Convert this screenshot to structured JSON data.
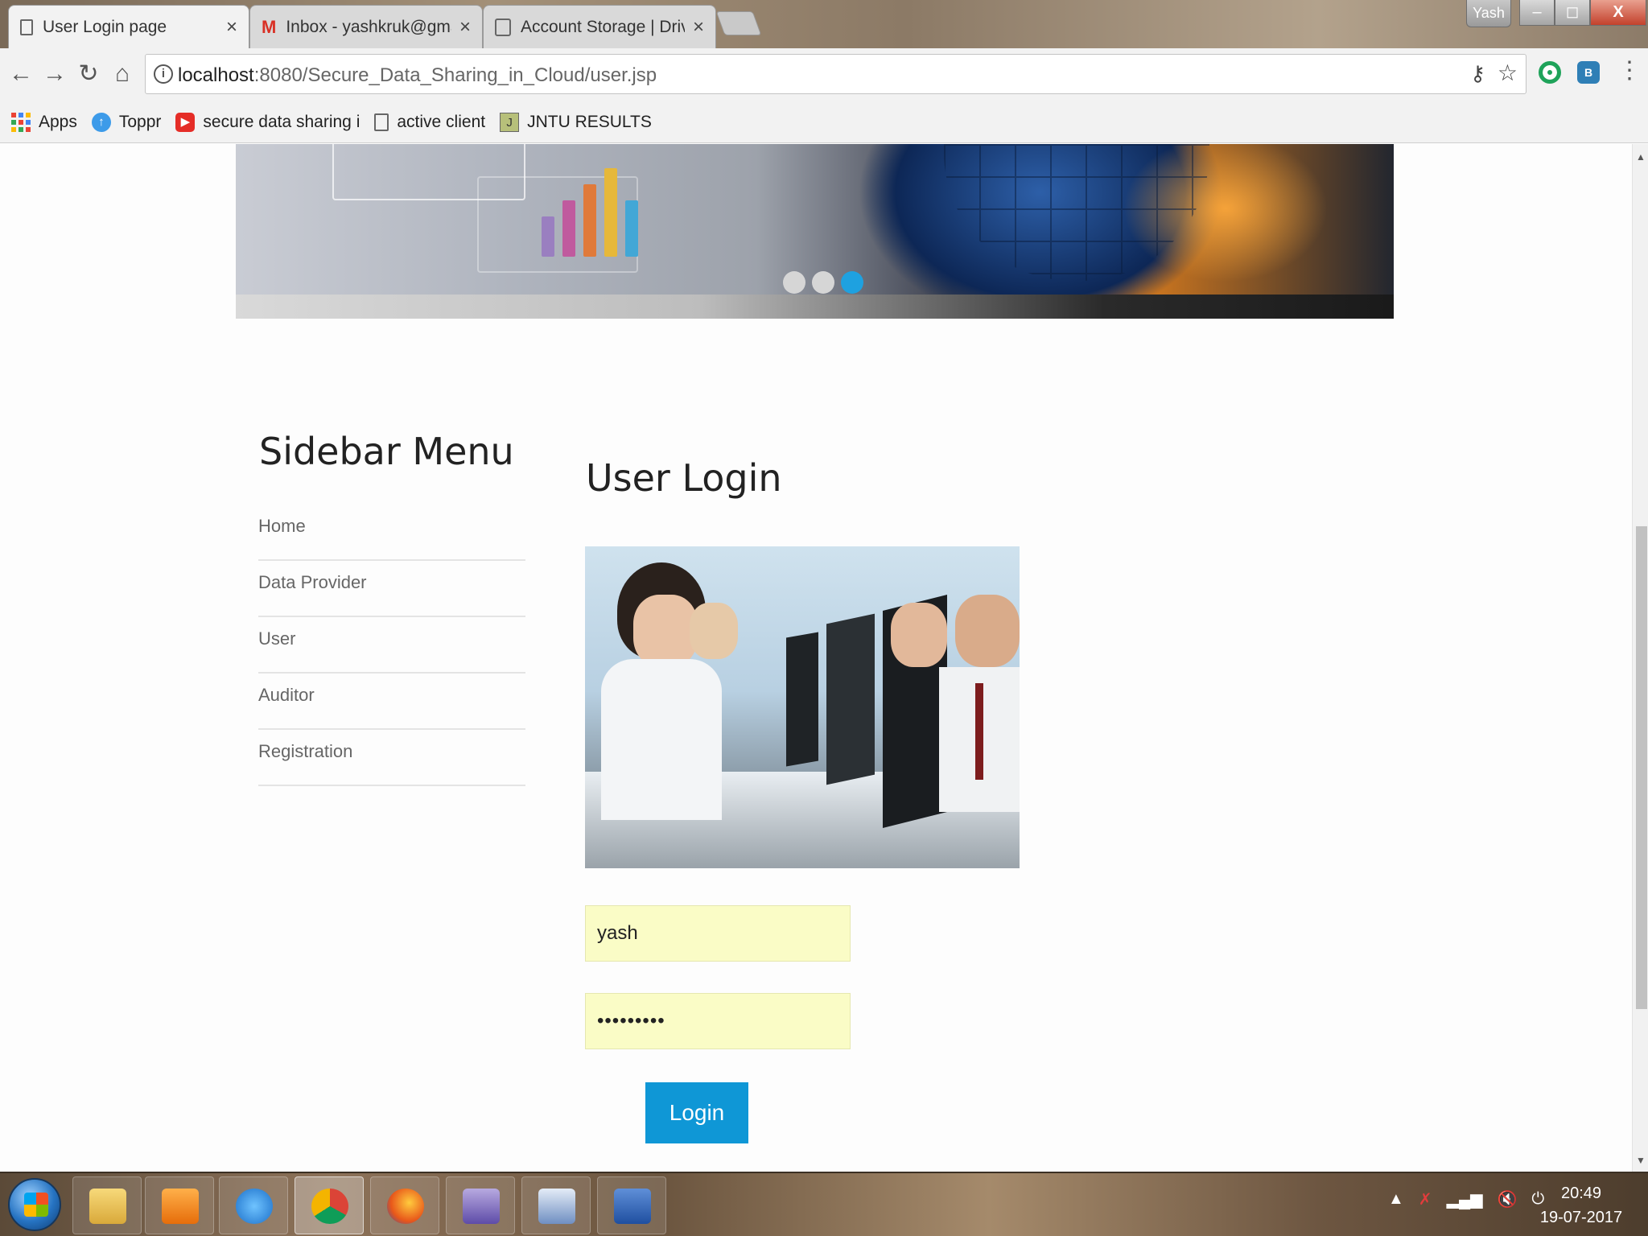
{
  "browser": {
    "tabs": [
      {
        "title": "User Login page",
        "active": true
      },
      {
        "title": "Inbox - yashkruk@gmail",
        "active": false
      },
      {
        "title": "Account Storage | Drive",
        "active": false
      }
    ],
    "profile": "Yash",
    "window_controls": {
      "minimize": "–",
      "maximize": "◻",
      "close": "X"
    },
    "url_host": "localhost",
    "url_path": ":8080/Secure_Data_Sharing_in_Cloud/user.jsp",
    "bookmarks": [
      {
        "label": "Apps",
        "icon": "apps-grid-icon"
      },
      {
        "label": "Toppr",
        "icon": "toppr-icon"
      },
      {
        "label": "secure data sharing i",
        "icon": "youtube-icon"
      },
      {
        "label": "active client",
        "icon": "page-icon"
      },
      {
        "label": "JNTU RESULTS",
        "icon": "jntu-icon"
      }
    ]
  },
  "page": {
    "sidebar": {
      "title": "Sidebar Menu",
      "items": [
        "Home",
        "Data Provider",
        "User",
        "Auditor",
        "Registration"
      ]
    },
    "login": {
      "title": "User Login",
      "username_value": "yash",
      "password_value": "•••••••••",
      "button_label": "Login"
    },
    "slider": {
      "dot_count": 3,
      "active_dot": 3
    }
  },
  "taskbar": {
    "time": "20:49",
    "date": "19-07-2017",
    "apps": [
      "explorer-icon",
      "media-player-icon",
      "internet-explorer-icon",
      "chrome-icon",
      "firefox-icon",
      "app-icon",
      "virtualbox-icon",
      "word-icon"
    ]
  },
  "colors": {
    "accent": "#0f97d6",
    "input_bg": "#fafcc6",
    "active_dot": "#1ea1e0"
  }
}
